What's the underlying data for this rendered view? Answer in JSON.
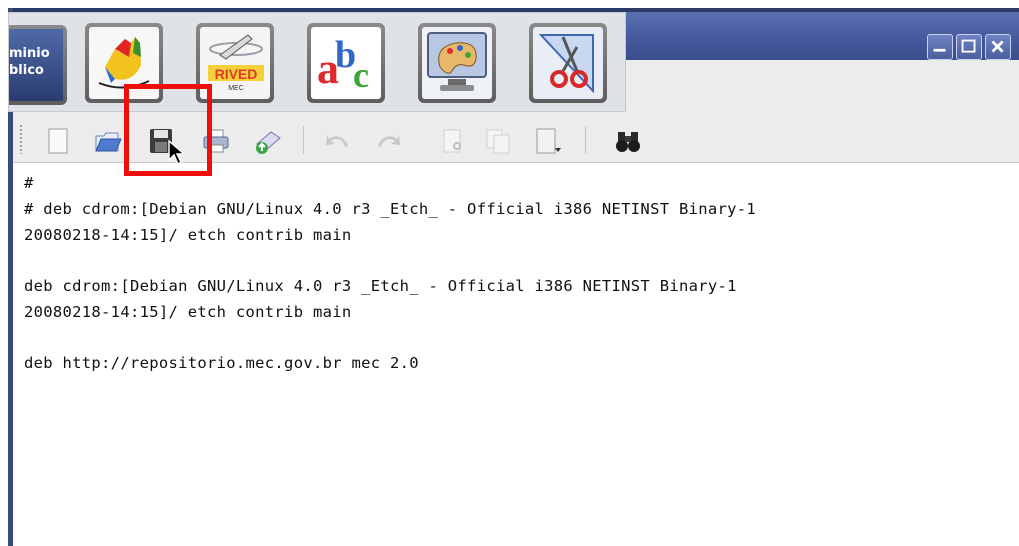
{
  "launcher": {
    "dominio_label_line1": "minio",
    "dominio_label_line2": "blico",
    "tiles": [
      {
        "name": "hand-app",
        "icon": "colorful-hand-icon"
      },
      {
        "name": "rived-mec",
        "icon": "rived-icon",
        "label": "RIVED",
        "sublabel": "MEC"
      },
      {
        "name": "abc-app",
        "icon": "abc-letters-icon",
        "label": "abc"
      },
      {
        "name": "paint-app",
        "icon": "paint-palette-icon"
      },
      {
        "name": "draw-app",
        "icon": "drafting-scissors-icon"
      }
    ]
  },
  "toolbar": {
    "buttons": [
      {
        "name": "new-document",
        "icon": "new-document-icon"
      },
      {
        "name": "open",
        "icon": "open-folder-icon"
      },
      {
        "name": "save",
        "icon": "save-floppy-icon"
      },
      {
        "name": "print",
        "icon": "printer-icon"
      },
      {
        "name": "save-as",
        "icon": "save-as-icon"
      },
      {
        "name": "undo",
        "icon": "undo-icon"
      },
      {
        "name": "redo",
        "icon": "redo-icon"
      },
      {
        "name": "cut",
        "icon": "cut-icon"
      },
      {
        "name": "copy",
        "icon": "copy-icon"
      },
      {
        "name": "paste",
        "icon": "paste-icon"
      },
      {
        "name": "find",
        "icon": "binoculars-icon"
      }
    ]
  },
  "editor": {
    "lines": [
      "#",
      "# deb cdrom:[Debian GNU/Linux 4.0 r3 _Etch_ - Official i386 NETINST Binary-1",
      "20080218-14:15]/ etch contrib main",
      "",
      "deb cdrom:[Debian GNU/Linux 4.0 r3 _Etch_ - Official i386 NETINST Binary-1",
      "20080218-14:15]/ etch contrib main",
      "",
      "deb http://repositorio.mec.gov.br mec 2.0"
    ]
  },
  "colors": {
    "titlebar": "#43579a",
    "highlight_box": "#ef0e0e",
    "toolbar_bg": "#ececec"
  }
}
